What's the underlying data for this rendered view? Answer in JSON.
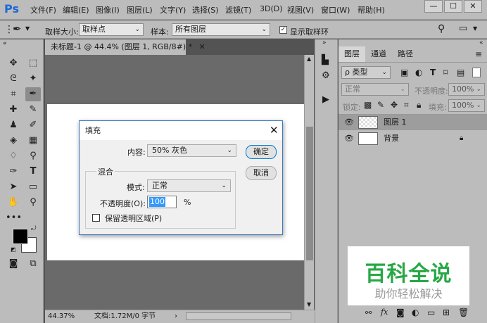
{
  "app": {
    "logo": "Ps"
  },
  "menu": [
    "文件(F)",
    "编辑(E)",
    "图像(I)",
    "图层(L)",
    "文字(Y)",
    "选择(S)",
    "滤镜(T)",
    "3D(D)",
    "视图(V)",
    "窗口(W)",
    "帮助(H)"
  ],
  "window_controls": {
    "minimize": "—",
    "maximize": "☐",
    "close": "✕"
  },
  "options": {
    "sample_size_label": "取样大小:",
    "sample_size_value": "取样点",
    "sample_label": "样本:",
    "sample_value": "所有图层",
    "show_ring_label": "显示取样环",
    "show_ring_checked": true
  },
  "document": {
    "tab_title": "未标题-1 @ 44.4% (图层 1, RGB/8#) *",
    "zoom": "44.37%",
    "doc_info": "文档:1.72M/0 字节"
  },
  "layers_panel": {
    "tabs": [
      "图层",
      "通道",
      "路径"
    ],
    "filter_kind": "ρ 类型",
    "blend_mode": "正常",
    "opacity_label": "不透明度:",
    "opacity_value": "100%",
    "lock_label": "锁定:",
    "fill_label": "填充:",
    "fill_value": "100%",
    "layers": [
      {
        "name": "图层 1",
        "selected": true
      },
      {
        "name": "背景",
        "locked": true
      }
    ]
  },
  "watermark": {
    "title": "百科全说",
    "subtitle": "助你轻松解决",
    "title_color": "#27a844"
  },
  "dialog": {
    "title": "填充",
    "content_label": "内容:",
    "content_value": "50% 灰色",
    "ok": "确定",
    "cancel": "取消",
    "blend_group": "混合",
    "mode_label": "模式:",
    "mode_value": "正常",
    "opacity_label": "不透明度(O):",
    "opacity_value": "100",
    "opacity_unit": "%",
    "preserve_label": "保留透明区域(P)",
    "preserve_checked": false
  }
}
